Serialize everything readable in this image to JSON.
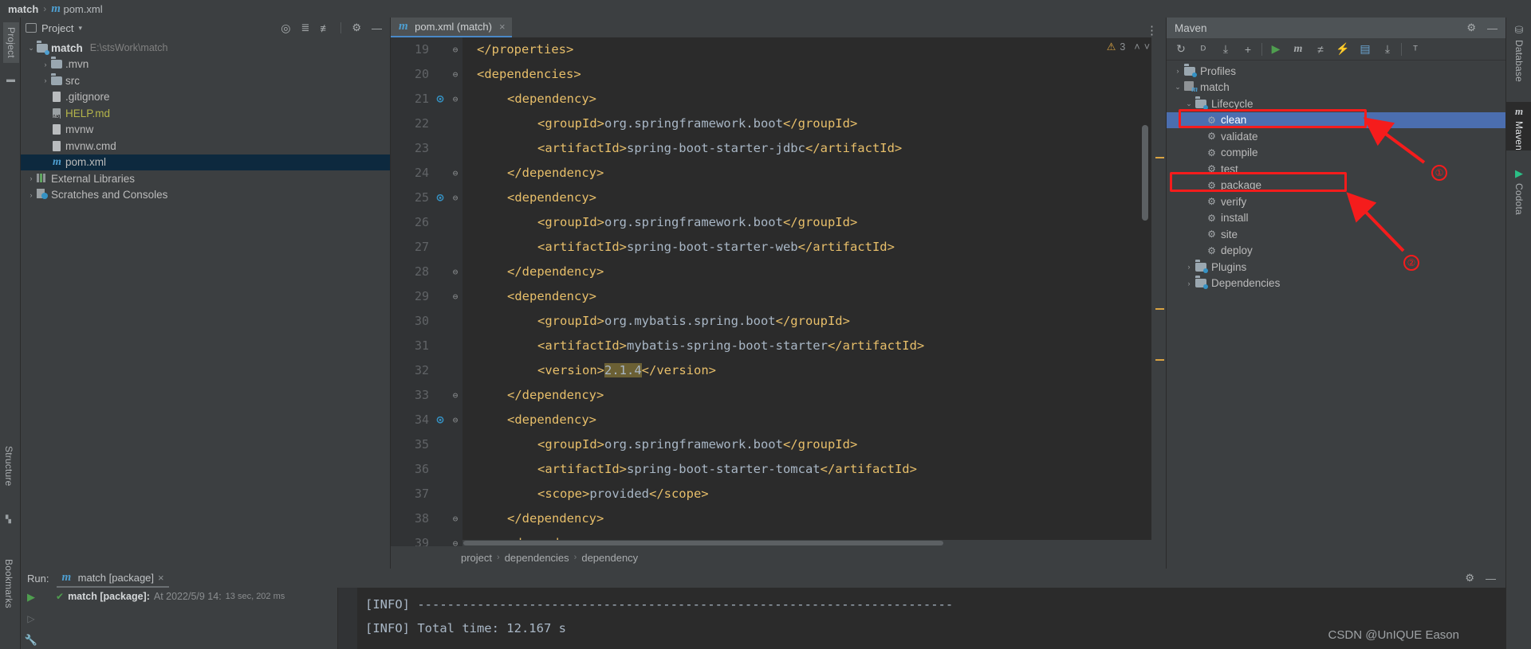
{
  "window": {
    "breadcrumb_project": "match",
    "breadcrumb_file": "pom.xml",
    "breadcrumb_sep": "›"
  },
  "left_strip": {
    "project_label": "Project",
    "structure_label": "Structure",
    "bookmarks_label": "Bookmarks"
  },
  "right_strip": {
    "items": [
      {
        "label": "Database",
        "icon": "database-icon"
      },
      {
        "label": "Maven",
        "icon": "maven-m-icon"
      },
      {
        "label": "Codota",
        "icon": "codota-icon"
      }
    ]
  },
  "project_panel": {
    "title": "Project",
    "dropdown_caret": "▾",
    "toolbar_icons": [
      "locate-icon",
      "expand-all-icon",
      "collapse-all-icon",
      "gear-icon",
      "hide-icon"
    ],
    "tree": [
      {
        "arrow": "⌄",
        "icon": "module-folder-icon",
        "label": "match",
        "path": "E:\\stsWork\\match",
        "bold": true,
        "indent": 0,
        "selected": false
      },
      {
        "arrow": "›",
        "icon": "folder-icon",
        "label": ".mvn",
        "path": "",
        "bold": false,
        "indent": 1,
        "selected": false
      },
      {
        "arrow": "›",
        "icon": "folder-icon",
        "label": "src",
        "path": "",
        "bold": false,
        "indent": 1,
        "selected": false
      },
      {
        "arrow": "",
        "icon": "gitignore-file-icon",
        "label": ".gitignore",
        "path": "",
        "bold": false,
        "indent": 1,
        "selected": false
      },
      {
        "arrow": "",
        "icon": "markdown-file-icon",
        "label": "HELP.md",
        "path": "",
        "bold": false,
        "indent": 1,
        "selected": false
      },
      {
        "arrow": "",
        "icon": "script-file-icon",
        "label": "mvnw",
        "path": "",
        "bold": false,
        "indent": 1,
        "selected": false
      },
      {
        "arrow": "",
        "icon": "cmd-file-icon",
        "label": "mvnw.cmd",
        "path": "",
        "bold": false,
        "indent": 1,
        "selected": false
      },
      {
        "arrow": "",
        "icon": "maven-m-icon",
        "label": "pom.xml",
        "path": "",
        "bold": false,
        "indent": 1,
        "selected": true
      },
      {
        "arrow": "›",
        "icon": "libraries-icon",
        "label": "External Libraries",
        "path": "",
        "bold": false,
        "indent": 0,
        "selected": false
      },
      {
        "arrow": "›",
        "icon": "scratches-icon",
        "label": "Scratches and Consoles",
        "path": "",
        "bold": false,
        "indent": 0,
        "selected": false
      }
    ]
  },
  "editor": {
    "tab_label": "pom.xml (match)",
    "tab_icon": "maven-m-icon",
    "tab_close": "×",
    "options_icon": "more-options-icon",
    "warning_count": "3",
    "warning_icon": "warning-triangle-icon",
    "nav_up": "˄",
    "nav_down": "˅",
    "breadcrumbs": [
      "project",
      "dependencies",
      "dependency"
    ],
    "breadcrumb_sep": "›",
    "lines": [
      {
        "no": "19",
        "fold": "⊖",
        "dl": false,
        "indent": 2,
        "parts": [
          {
            "t": "</properties>",
            "c": "tag"
          }
        ]
      },
      {
        "no": "20",
        "fold": "⊖",
        "dl": false,
        "indent": 2,
        "parts": [
          {
            "t": "<dependencies>",
            "c": "tag"
          }
        ]
      },
      {
        "no": "21",
        "fold": "⊖",
        "dl": true,
        "indent": 3,
        "parts": [
          {
            "t": "<dependency>",
            "c": "tag"
          }
        ]
      },
      {
        "no": "22",
        "fold": "",
        "dl": false,
        "indent": 4,
        "parts": [
          {
            "t": "<groupId>",
            "c": "tag"
          },
          {
            "t": "org.springframework.boot",
            "c": "txt"
          },
          {
            "t": "</groupId>",
            "c": "tag"
          }
        ]
      },
      {
        "no": "23",
        "fold": "",
        "dl": false,
        "indent": 4,
        "parts": [
          {
            "t": "<artifactId>",
            "c": "tag"
          },
          {
            "t": "spring-boot-starter-jdbc",
            "c": "txt"
          },
          {
            "t": "</artifactId>",
            "c": "tag"
          }
        ]
      },
      {
        "no": "24",
        "fold": "⊖",
        "dl": false,
        "indent": 3,
        "parts": [
          {
            "t": "</dependency>",
            "c": "tag"
          }
        ]
      },
      {
        "no": "25",
        "fold": "⊖",
        "dl": true,
        "indent": 3,
        "parts": [
          {
            "t": "<dependency>",
            "c": "tag"
          }
        ]
      },
      {
        "no": "26",
        "fold": "",
        "dl": false,
        "indent": 4,
        "parts": [
          {
            "t": "<groupId>",
            "c": "tag"
          },
          {
            "t": "org.springframework.boot",
            "c": "txt"
          },
          {
            "t": "</groupId>",
            "c": "tag"
          }
        ]
      },
      {
        "no": "27",
        "fold": "",
        "dl": false,
        "indent": 4,
        "parts": [
          {
            "t": "<artifactId>",
            "c": "tag"
          },
          {
            "t": "spring-boot-starter-web",
            "c": "txt"
          },
          {
            "t": "</artifactId>",
            "c": "tag"
          }
        ]
      },
      {
        "no": "28",
        "fold": "⊖",
        "dl": false,
        "indent": 3,
        "parts": [
          {
            "t": "</dependency>",
            "c": "tag"
          }
        ]
      },
      {
        "no": "29",
        "fold": "⊖",
        "dl": false,
        "indent": 3,
        "parts": [
          {
            "t": "<dependency>",
            "c": "tag"
          }
        ]
      },
      {
        "no": "30",
        "fold": "",
        "dl": false,
        "indent": 4,
        "parts": [
          {
            "t": "<groupId>",
            "c": "tag"
          },
          {
            "t": "org.mybatis.spring.boot",
            "c": "txt"
          },
          {
            "t": "</groupId>",
            "c": "tag"
          }
        ]
      },
      {
        "no": "31",
        "fold": "",
        "dl": false,
        "indent": 4,
        "parts": [
          {
            "t": "<artifactId>",
            "c": "tag"
          },
          {
            "t": "mybatis-spring-boot-starter",
            "c": "txt"
          },
          {
            "t": "</artifactId>",
            "c": "tag"
          }
        ]
      },
      {
        "no": "32",
        "fold": "",
        "dl": false,
        "indent": 4,
        "parts": [
          {
            "t": "<version>",
            "c": "tag"
          },
          {
            "t": "2.1.4",
            "c": "txt hl"
          },
          {
            "t": "</version>",
            "c": "tag"
          }
        ]
      },
      {
        "no": "33",
        "fold": "⊖",
        "dl": false,
        "indent": 3,
        "parts": [
          {
            "t": "</dependency>",
            "c": "tag"
          }
        ]
      },
      {
        "no": "34",
        "fold": "⊖",
        "dl": true,
        "indent": 3,
        "parts": [
          {
            "t": "<dependency>",
            "c": "tag"
          }
        ]
      },
      {
        "no": "35",
        "fold": "",
        "dl": false,
        "indent": 4,
        "parts": [
          {
            "t": "<groupId>",
            "c": "tag"
          },
          {
            "t": "org.springframework.boot",
            "c": "txt"
          },
          {
            "t": "</groupId>",
            "c": "tag"
          }
        ]
      },
      {
        "no": "36",
        "fold": "",
        "dl": false,
        "indent": 4,
        "parts": [
          {
            "t": "<artifactId>",
            "c": "tag"
          },
          {
            "t": "spring-boot-starter-tomcat",
            "c": "txt"
          },
          {
            "t": "</artifactId>",
            "c": "tag"
          }
        ]
      },
      {
        "no": "37",
        "fold": "",
        "dl": false,
        "indent": 4,
        "parts": [
          {
            "t": "<scope>",
            "c": "tag"
          },
          {
            "t": "provided",
            "c": "txt"
          },
          {
            "t": "</scope>",
            "c": "tag"
          }
        ]
      },
      {
        "no": "38",
        "fold": "⊖",
        "dl": false,
        "indent": 3,
        "parts": [
          {
            "t": "</dependency>",
            "c": "tag"
          }
        ]
      },
      {
        "no": "39",
        "fold": "⊖",
        "dl": false,
        "indent": 3,
        "parts": [
          {
            "t": "<dependency>",
            "c": "tag"
          }
        ]
      }
    ]
  },
  "maven_panel": {
    "title": "Maven",
    "head_icons": [
      "gear-icon",
      "minimize-icon"
    ],
    "toolbar": [
      {
        "name": "reload-all-maven-projects-icon",
        "glyph": "↻"
      },
      {
        "name": "generate-sources-icon",
        "glyph": "ᴰ"
      },
      {
        "name": "download-sources-icon",
        "glyph": "⤓"
      },
      {
        "name": "add-maven-project-icon",
        "glyph": "+"
      },
      {
        "name": "run-maven-build-icon",
        "glyph": "▶"
      },
      {
        "name": "execute-maven-goal-icon",
        "glyph": "m"
      },
      {
        "name": "toggle-skip-tests-icon",
        "glyph": "≠"
      },
      {
        "name": "toggle-offline-mode-icon",
        "glyph": "⚡"
      },
      {
        "name": "show-dependencies-icon",
        "glyph": "▤"
      },
      {
        "name": "collapse-all-icon",
        "glyph": "⤓"
      },
      {
        "name": "maven-settings-icon",
        "glyph": "ᵀ"
      }
    ],
    "tree": [
      {
        "arrow": "›",
        "icon": "profiles-icon",
        "label": "Profiles",
        "indent": 0,
        "selected": false,
        "kind": "folder"
      },
      {
        "arrow": "⌄",
        "icon": "maven-project-icon",
        "label": "match",
        "indent": 0,
        "selected": false,
        "kind": "project"
      },
      {
        "arrow": "⌄",
        "icon": "lifecycle-folder-icon",
        "label": "Lifecycle",
        "indent": 1,
        "selected": false,
        "kind": "folder"
      },
      {
        "arrow": "",
        "icon": "goal-gear-icon",
        "label": "clean",
        "indent": 2,
        "selected": true,
        "kind": "goal"
      },
      {
        "arrow": "",
        "icon": "goal-gear-icon",
        "label": "validate",
        "indent": 2,
        "selected": false,
        "kind": "goal"
      },
      {
        "arrow": "",
        "icon": "goal-gear-icon",
        "label": "compile",
        "indent": 2,
        "selected": false,
        "kind": "goal"
      },
      {
        "arrow": "",
        "icon": "goal-gear-icon",
        "label": "test",
        "indent": 2,
        "selected": false,
        "kind": "goal"
      },
      {
        "arrow": "",
        "icon": "goal-gear-icon",
        "label": "package",
        "indent": 2,
        "selected": false,
        "kind": "goal"
      },
      {
        "arrow": "",
        "icon": "goal-gear-icon",
        "label": "verify",
        "indent": 2,
        "selected": false,
        "kind": "goal"
      },
      {
        "arrow": "",
        "icon": "goal-gear-icon",
        "label": "install",
        "indent": 2,
        "selected": false,
        "kind": "goal"
      },
      {
        "arrow": "",
        "icon": "goal-gear-icon",
        "label": "site",
        "indent": 2,
        "selected": false,
        "kind": "goal"
      },
      {
        "arrow": "",
        "icon": "goal-gear-icon",
        "label": "deploy",
        "indent": 2,
        "selected": false,
        "kind": "goal"
      },
      {
        "arrow": "›",
        "icon": "plugins-folder-icon",
        "label": "Plugins",
        "indent": 1,
        "selected": false,
        "kind": "folder"
      },
      {
        "arrow": "›",
        "icon": "dependencies-folder-icon",
        "label": "Dependencies",
        "indent": 1,
        "selected": false,
        "kind": "folder"
      }
    ]
  },
  "run_panel": {
    "label": "Run:",
    "tab_label": "match [package]",
    "tab_icon": "maven-m-icon",
    "tab_close": "×",
    "tools": [
      "gear-icon",
      "minimize-icon"
    ],
    "side_icons": [
      "rerun-icon",
      "rerun-failed-icon",
      "settings-wrench-icon"
    ],
    "result": {
      "status_icon": "check-icon",
      "name": "match [package]:",
      "at": "At 2022/5/9 14:",
      "duration": "13 sec, 202 ms"
    },
    "console_lines": [
      "[INFO] ------------------------------------------------------------------------",
      "[INFO] Total time:  12.167 s"
    ]
  },
  "annotations": {
    "marker_color": "#f51c1c",
    "items": [
      {
        "number": "①",
        "target": "maven-goal-clean"
      },
      {
        "number": "②",
        "target": "maven-goal-package"
      }
    ]
  }
}
